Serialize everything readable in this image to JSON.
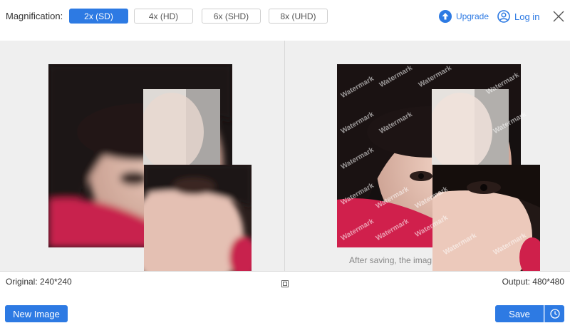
{
  "toolbar": {
    "magnification_label": "Magnification:",
    "options": [
      "2x (SD)",
      "4x (HD)",
      "6x (SHD)",
      "8x (UHD)"
    ],
    "selected_index": 0,
    "upgrade_label": "Upgrade",
    "login_label": "Log in"
  },
  "preview": {
    "watermark_text": "Watermark",
    "save_note": "After saving, the imag"
  },
  "info": {
    "original": "Original: 240*240",
    "output": "Output: 480*480"
  },
  "footer": {
    "new_image_label": "New Image",
    "save_label": "Save"
  },
  "colors": {
    "accent": "#2d7ae3",
    "canvas_bg": "#efefef"
  }
}
